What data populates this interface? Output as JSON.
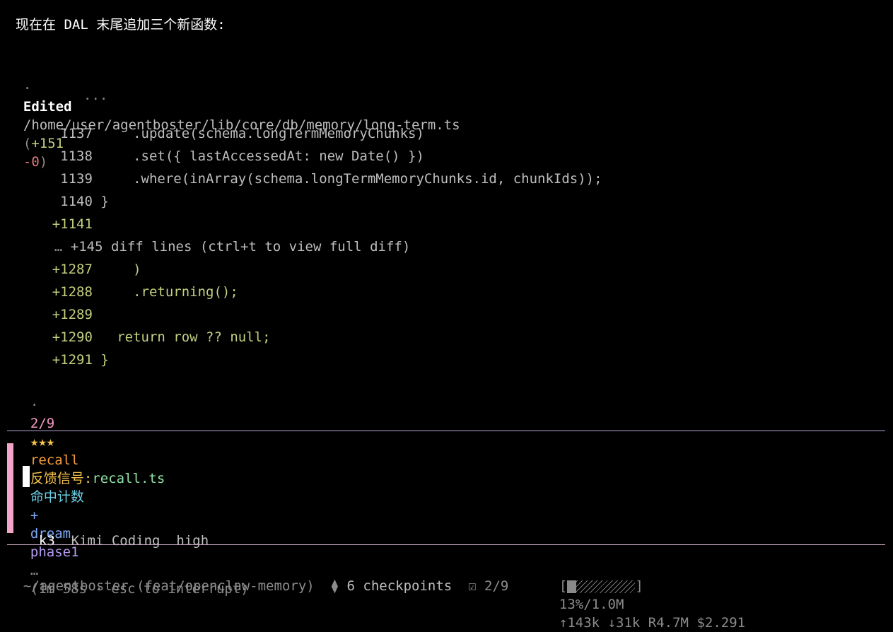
{
  "message": "现在在 DAL 末尾追加三个新函数:",
  "edit": {
    "bullet": "·",
    "label": "Edited",
    "path": "/home/user/agentboster/lib/core/db/memory/long-term.ts",
    "paren_open": "(",
    "added": "+151",
    "removed": "-0",
    "paren_close": ")"
  },
  "diff": {
    "ellipsis": "...",
    "lines": [
      {
        "num": "1137",
        "code": "    .update(schema.longTermMemoryChunks)"
      },
      {
        "num": "1138",
        "code": "    .set({ lastAccessedAt: new Date() })"
      },
      {
        "num": "1139",
        "code": "    .where(inArray(schema.longTermMemoryChunks.id, chunkIds));"
      },
      {
        "num": "1140",
        "code": "}"
      },
      {
        "num": "+1141",
        "code": ""
      },
      {
        "num": "+1287",
        "code": "    )"
      },
      {
        "num": "+1288",
        "code": "    .returning();"
      },
      {
        "num": "+1289",
        "code": ""
      },
      {
        "num": "+1290",
        "code": "  return row ?? null;"
      },
      {
        "num": "+1291",
        "code": "}"
      }
    ],
    "collapsed": {
      "prefix": "…",
      "count": "+145",
      "text": "diff lines (ctrl+t to view full diff)"
    }
  },
  "task": {
    "bullet": "·",
    "progress": "2/9",
    "stars": "★★★",
    "word1": "recall",
    "word2": "反馈信号:",
    "word3": "recall.ts",
    "word4": "命中计数",
    "plus": "+",
    "word5": "dream",
    "word6": "phase1",
    "ellipsis": "…",
    "timer": "(1m 58s · esc to interrupt)"
  },
  "input": {
    "value": ""
  },
  "model": {
    "id": "k3",
    "name": "Kimi Coding",
    "effort": "high"
  },
  "status": {
    "cwd": "~/agentboster (feat/openclaw-memory)",
    "checkpoint_icon": "⧫",
    "checkpoints": "6 checkpoints",
    "todo_icon": "☑",
    "todo": "2/9",
    "ctx_open": "[",
    "ctx_close": "]",
    "ctx_fill": 0.13,
    "context": "13%/1.0M",
    "up_icon": "↑",
    "up": "143k",
    "down_icon": "↓",
    "down": "31k",
    "reads": "R4.7M",
    "cost": "$2.291"
  },
  "colors": {
    "accent_pink": "#f2a5c8",
    "separator_top": "#b9a7d6",
    "separator_bottom": "#c9a9c0"
  }
}
